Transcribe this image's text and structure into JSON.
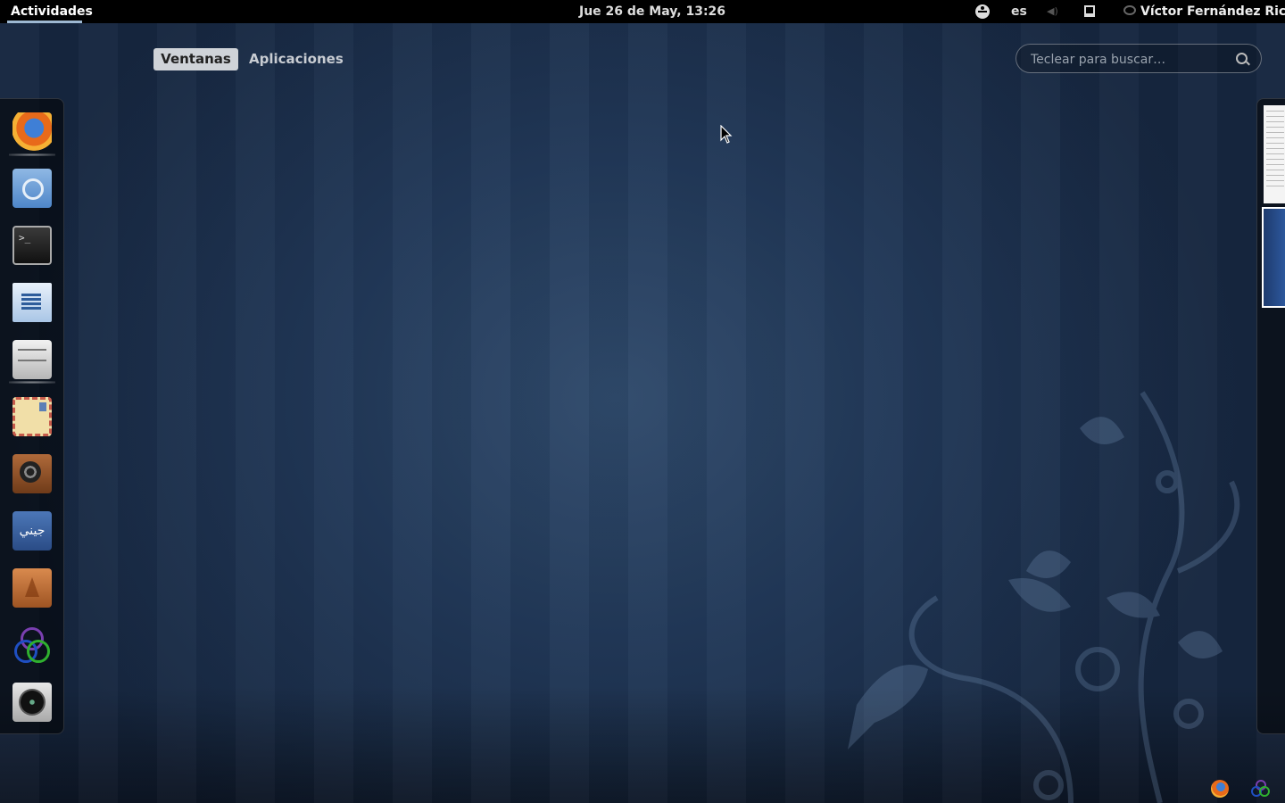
{
  "top_panel": {
    "activities": "Actividades",
    "clock": "Jue 26 de May, 13:26",
    "language": "es",
    "user_name": "Víctor Fernández Rico"
  },
  "overview": {
    "tabs": [
      "Ventanas",
      "Aplicaciones"
    ],
    "active_tab": "Ventanas",
    "search": {
      "placeholder": "Teclear para buscar…",
      "value": ""
    }
  },
  "dash": {
    "apps": [
      {
        "icon": "firefox-icon",
        "running": true
      },
      {
        "icon": "chromium-icon",
        "running": false
      },
      {
        "icon": "terminal-icon",
        "running": false
      },
      {
        "icon": "libreoffice-writer-icon",
        "running": false
      },
      {
        "icon": "file-manager-icon",
        "running": true
      },
      {
        "icon": "mail-icon",
        "running": false
      },
      {
        "icon": "sound-player-icon",
        "running": false
      },
      {
        "icon": "arabic-app-icon",
        "running": false
      },
      {
        "icon": "tree-app-icon",
        "running": false
      },
      {
        "icon": "rings-app-icon",
        "running": false
      },
      {
        "icon": "camera-icon",
        "running": false
      }
    ],
    "arabic_label": "جيني"
  },
  "workspaces": {
    "count": 2,
    "active": 2
  },
  "tray": [
    "firefox-icon",
    "rings-app-icon"
  ],
  "colors": {
    "panel": "#000000",
    "background": "#1a2b47",
    "accent": "#9db8d2"
  }
}
